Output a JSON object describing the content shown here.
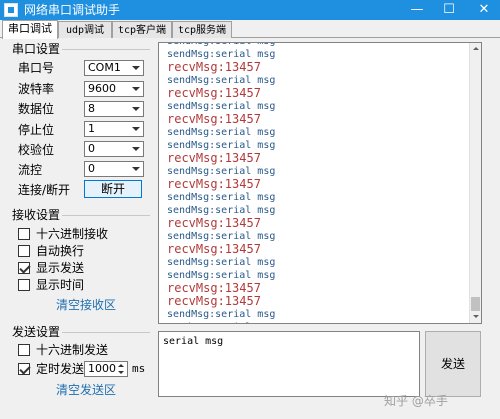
{
  "window": {
    "title": "网络串口调试助手",
    "min_glyph": "—",
    "max_glyph": "☐",
    "close_glyph": "✕"
  },
  "tabs": [
    {
      "label": "串口调试",
      "active": true
    },
    {
      "label": "udp调试",
      "active": false
    },
    {
      "label": "tcp客户端",
      "active": false
    },
    {
      "label": "tcp服务端",
      "active": false
    }
  ],
  "serial_settings": {
    "title": "串口设置",
    "port": {
      "label": "串口号",
      "value": "COM1"
    },
    "baud": {
      "label": "波特率",
      "value": "9600"
    },
    "databits": {
      "label": "数据位",
      "value": "8"
    },
    "stopbits": {
      "label": "停止位",
      "value": "1"
    },
    "parity": {
      "label": "校验位",
      "value": "0"
    },
    "flow": {
      "label": "流控",
      "value": "0"
    },
    "connect": {
      "label": "连接/断开",
      "button": "断开"
    }
  },
  "receive_settings": {
    "title": "接收设置",
    "hex": {
      "label": "十六进制接收",
      "checked": false
    },
    "wrap": {
      "label": "自动换行",
      "checked": false
    },
    "show_send": {
      "label": "显示发送",
      "checked": true
    },
    "show_time": {
      "label": "显示时间",
      "checked": false
    },
    "clear": "清空接收区"
  },
  "send_settings": {
    "title": "发送设置",
    "hex": {
      "label": "十六进制发送",
      "checked": false
    },
    "timed": {
      "label": "定时发送",
      "checked": true
    },
    "interval": "1000",
    "unit": "ms",
    "clear": "清空发送区"
  },
  "log": {
    "lines": [
      {
        "type": "send",
        "text": "sendMsg:serial msg"
      },
      {
        "type": "send",
        "text": "sendMsg:serial msg"
      },
      {
        "type": "recv",
        "text": "recvMsg:13457"
      },
      {
        "type": "send",
        "text": "sendMsg:serial msg"
      },
      {
        "type": "recv",
        "text": "recvMsg:13457"
      },
      {
        "type": "send",
        "text": "sendMsg:serial msg"
      },
      {
        "type": "recv",
        "text": "recvMsg:13457"
      },
      {
        "type": "send",
        "text": "sendMsg:serial msg"
      },
      {
        "type": "send",
        "text": "sendMsg:serial msg"
      },
      {
        "type": "recv",
        "text": "recvMsg:13457"
      },
      {
        "type": "send",
        "text": "sendMsg:serial msg"
      },
      {
        "type": "recv",
        "text": "recvMsg:13457"
      },
      {
        "type": "send",
        "text": "sendMsg:serial msg"
      },
      {
        "type": "send",
        "text": "sendMsg:serial msg"
      },
      {
        "type": "recv",
        "text": "recvMsg:13457"
      },
      {
        "type": "send",
        "text": "sendMsg:serial msg"
      },
      {
        "type": "recv",
        "text": "recvMsg:13457"
      },
      {
        "type": "send",
        "text": "sendMsg:serial msg"
      },
      {
        "type": "send",
        "text": "sendMsg:serial msg"
      },
      {
        "type": "recv",
        "text": "recvMsg:13457"
      },
      {
        "type": "recv",
        "text": "recvMsg:13457"
      },
      {
        "type": "send",
        "text": "sendMsg:serial msg"
      },
      {
        "type": "send",
        "text": "sendMsg:serial msg"
      }
    ]
  },
  "send_area": {
    "text": "serial msg",
    "button": "发送"
  },
  "watermark": "知乎 @卒手"
}
